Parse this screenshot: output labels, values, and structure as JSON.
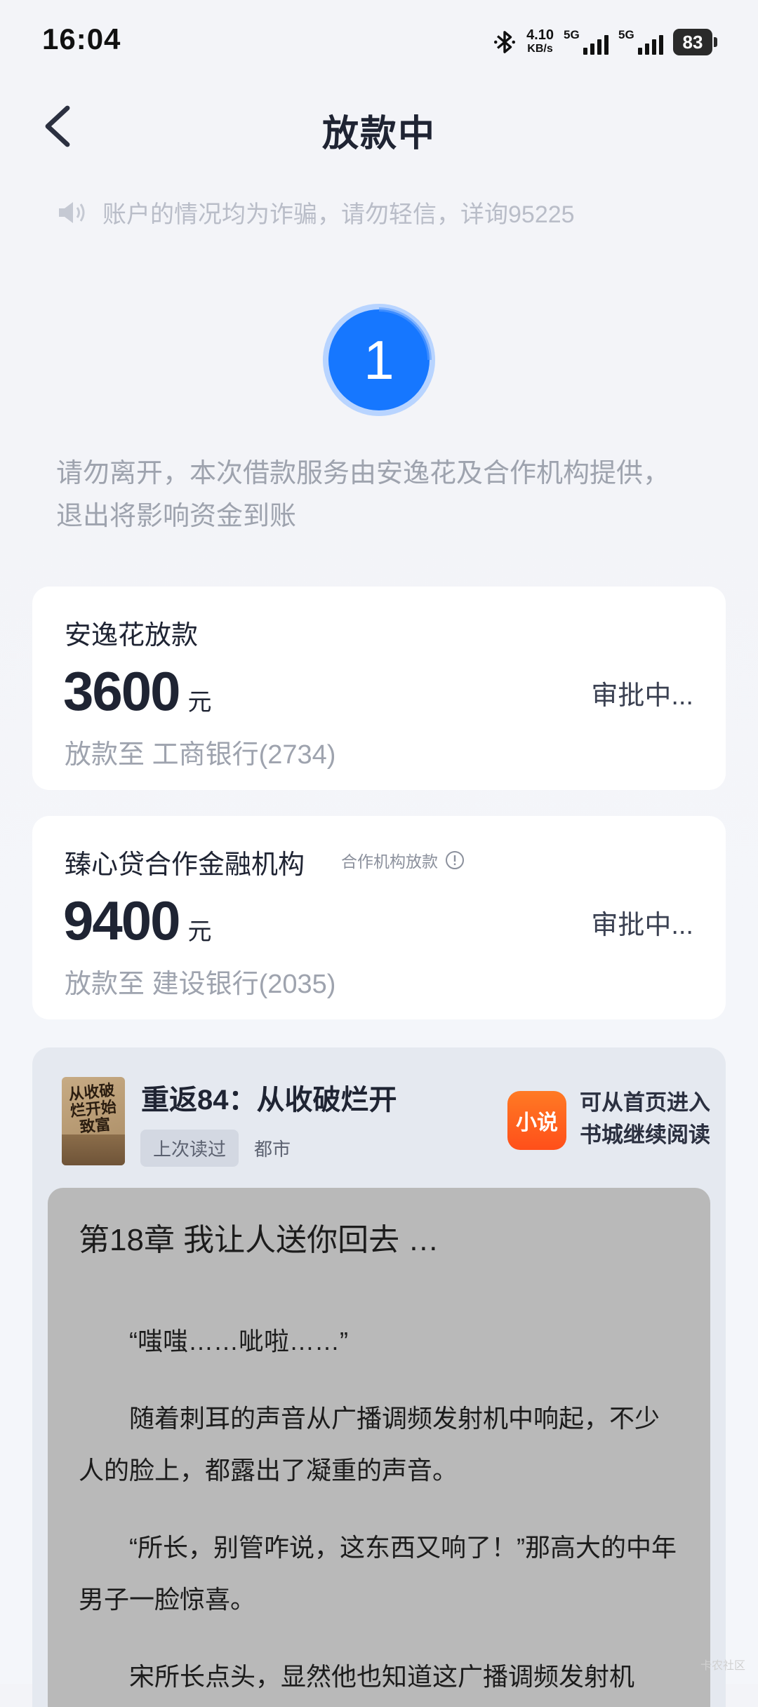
{
  "status_bar": {
    "time": "16:04",
    "net_speed_value": "4.10",
    "net_speed_unit": "KB/s",
    "sim1_label": "5G",
    "sim2_label": "5G",
    "battery": "83",
    "icons": [
      "bluetooth-icon",
      "signal-icon",
      "battery-icon"
    ]
  },
  "header": {
    "title": "放款中",
    "back_icon": "chevron-left-icon"
  },
  "notice": {
    "text": "账户的情况均为诈骗，请勿轻信，详询95225",
    "icon": "speaker-icon"
  },
  "progress": {
    "number": "1",
    "accent_color": "#1677ff"
  },
  "tip": "请勿离开，本次借款服务由安逸花及合作机构提供，退出将影响资金到账",
  "loans": [
    {
      "title": "安逸花放款",
      "amount": "3600",
      "unit": "元",
      "dest_label": "放款至",
      "bank": "工商银行(2734)",
      "status": "审批中..."
    },
    {
      "title": "臻心贷合作金融机构",
      "tag": "合作机构放款",
      "amount": "9400",
      "unit": "元",
      "dest_label": "放款至",
      "bank": "建设银行(2035)",
      "status": "审批中..."
    }
  ],
  "novel": {
    "cover_text": "从收破烂开始致富",
    "book_title": "重返84：从收破烂开",
    "read_tag": "上次读过",
    "genre": "都市",
    "app_logo_text": "小说",
    "app_hint_line1": "可从首页进入",
    "app_hint_line2": "书城继续阅读",
    "chapter_title": "第18章 我让人送你回去 …",
    "paragraphs": [
      "“嗤嗤……呲啦……”",
      "随着刺耳的声音从广播调频发射机中响起，不少人的脸上，都露出了凝重的声音。",
      "“所长，别管咋说，这东西又响了！”那高大的中年男子一脸惊喜。",
      "宋所长点头，显然他也知道这广播调频发射机"
    ]
  },
  "watermark": "卡农社区"
}
